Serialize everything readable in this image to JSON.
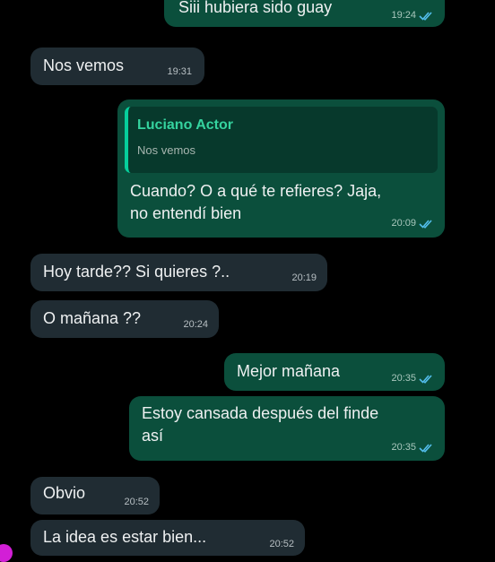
{
  "messages": [
    {
      "direction": "out",
      "text": "Siii hubiera sido guay",
      "time": "19:24",
      "read": true
    },
    {
      "direction": "in",
      "text": "Nos vemos",
      "time": "19:31"
    },
    {
      "direction": "out",
      "reply_to": {
        "author": "Luciano Actor",
        "text": "Nos vemos"
      },
      "text": "Cuando? O a qué te refieres? Jaja,\nno entendí bien",
      "time": "20:09",
      "read": true
    },
    {
      "direction": "in",
      "text": "Hoy tarde?? Si quieres ?..",
      "time": "20:19"
    },
    {
      "direction": "in",
      "text": "O mañana ??",
      "time": "20:24"
    },
    {
      "direction": "out",
      "text": "Mejor mañana",
      "time": "20:35",
      "read": true
    },
    {
      "direction": "out",
      "text": "Estoy cansada después del finde\nasí",
      "time": "20:35",
      "read": true
    },
    {
      "direction": "in",
      "text": "Obvio",
      "time": "20:52"
    },
    {
      "direction": "in",
      "text": "La idea es estar bien...",
      "time": "20:52"
    }
  ],
  "colors": {
    "background": "#000000",
    "incoming_bubble": "#202c33",
    "outgoing_bubble": "#0b4f3c",
    "quote_accent": "#06cf9c",
    "read_ticks": "#53bdeb"
  },
  "icons": {
    "read_receipt": "double-check-icon"
  }
}
